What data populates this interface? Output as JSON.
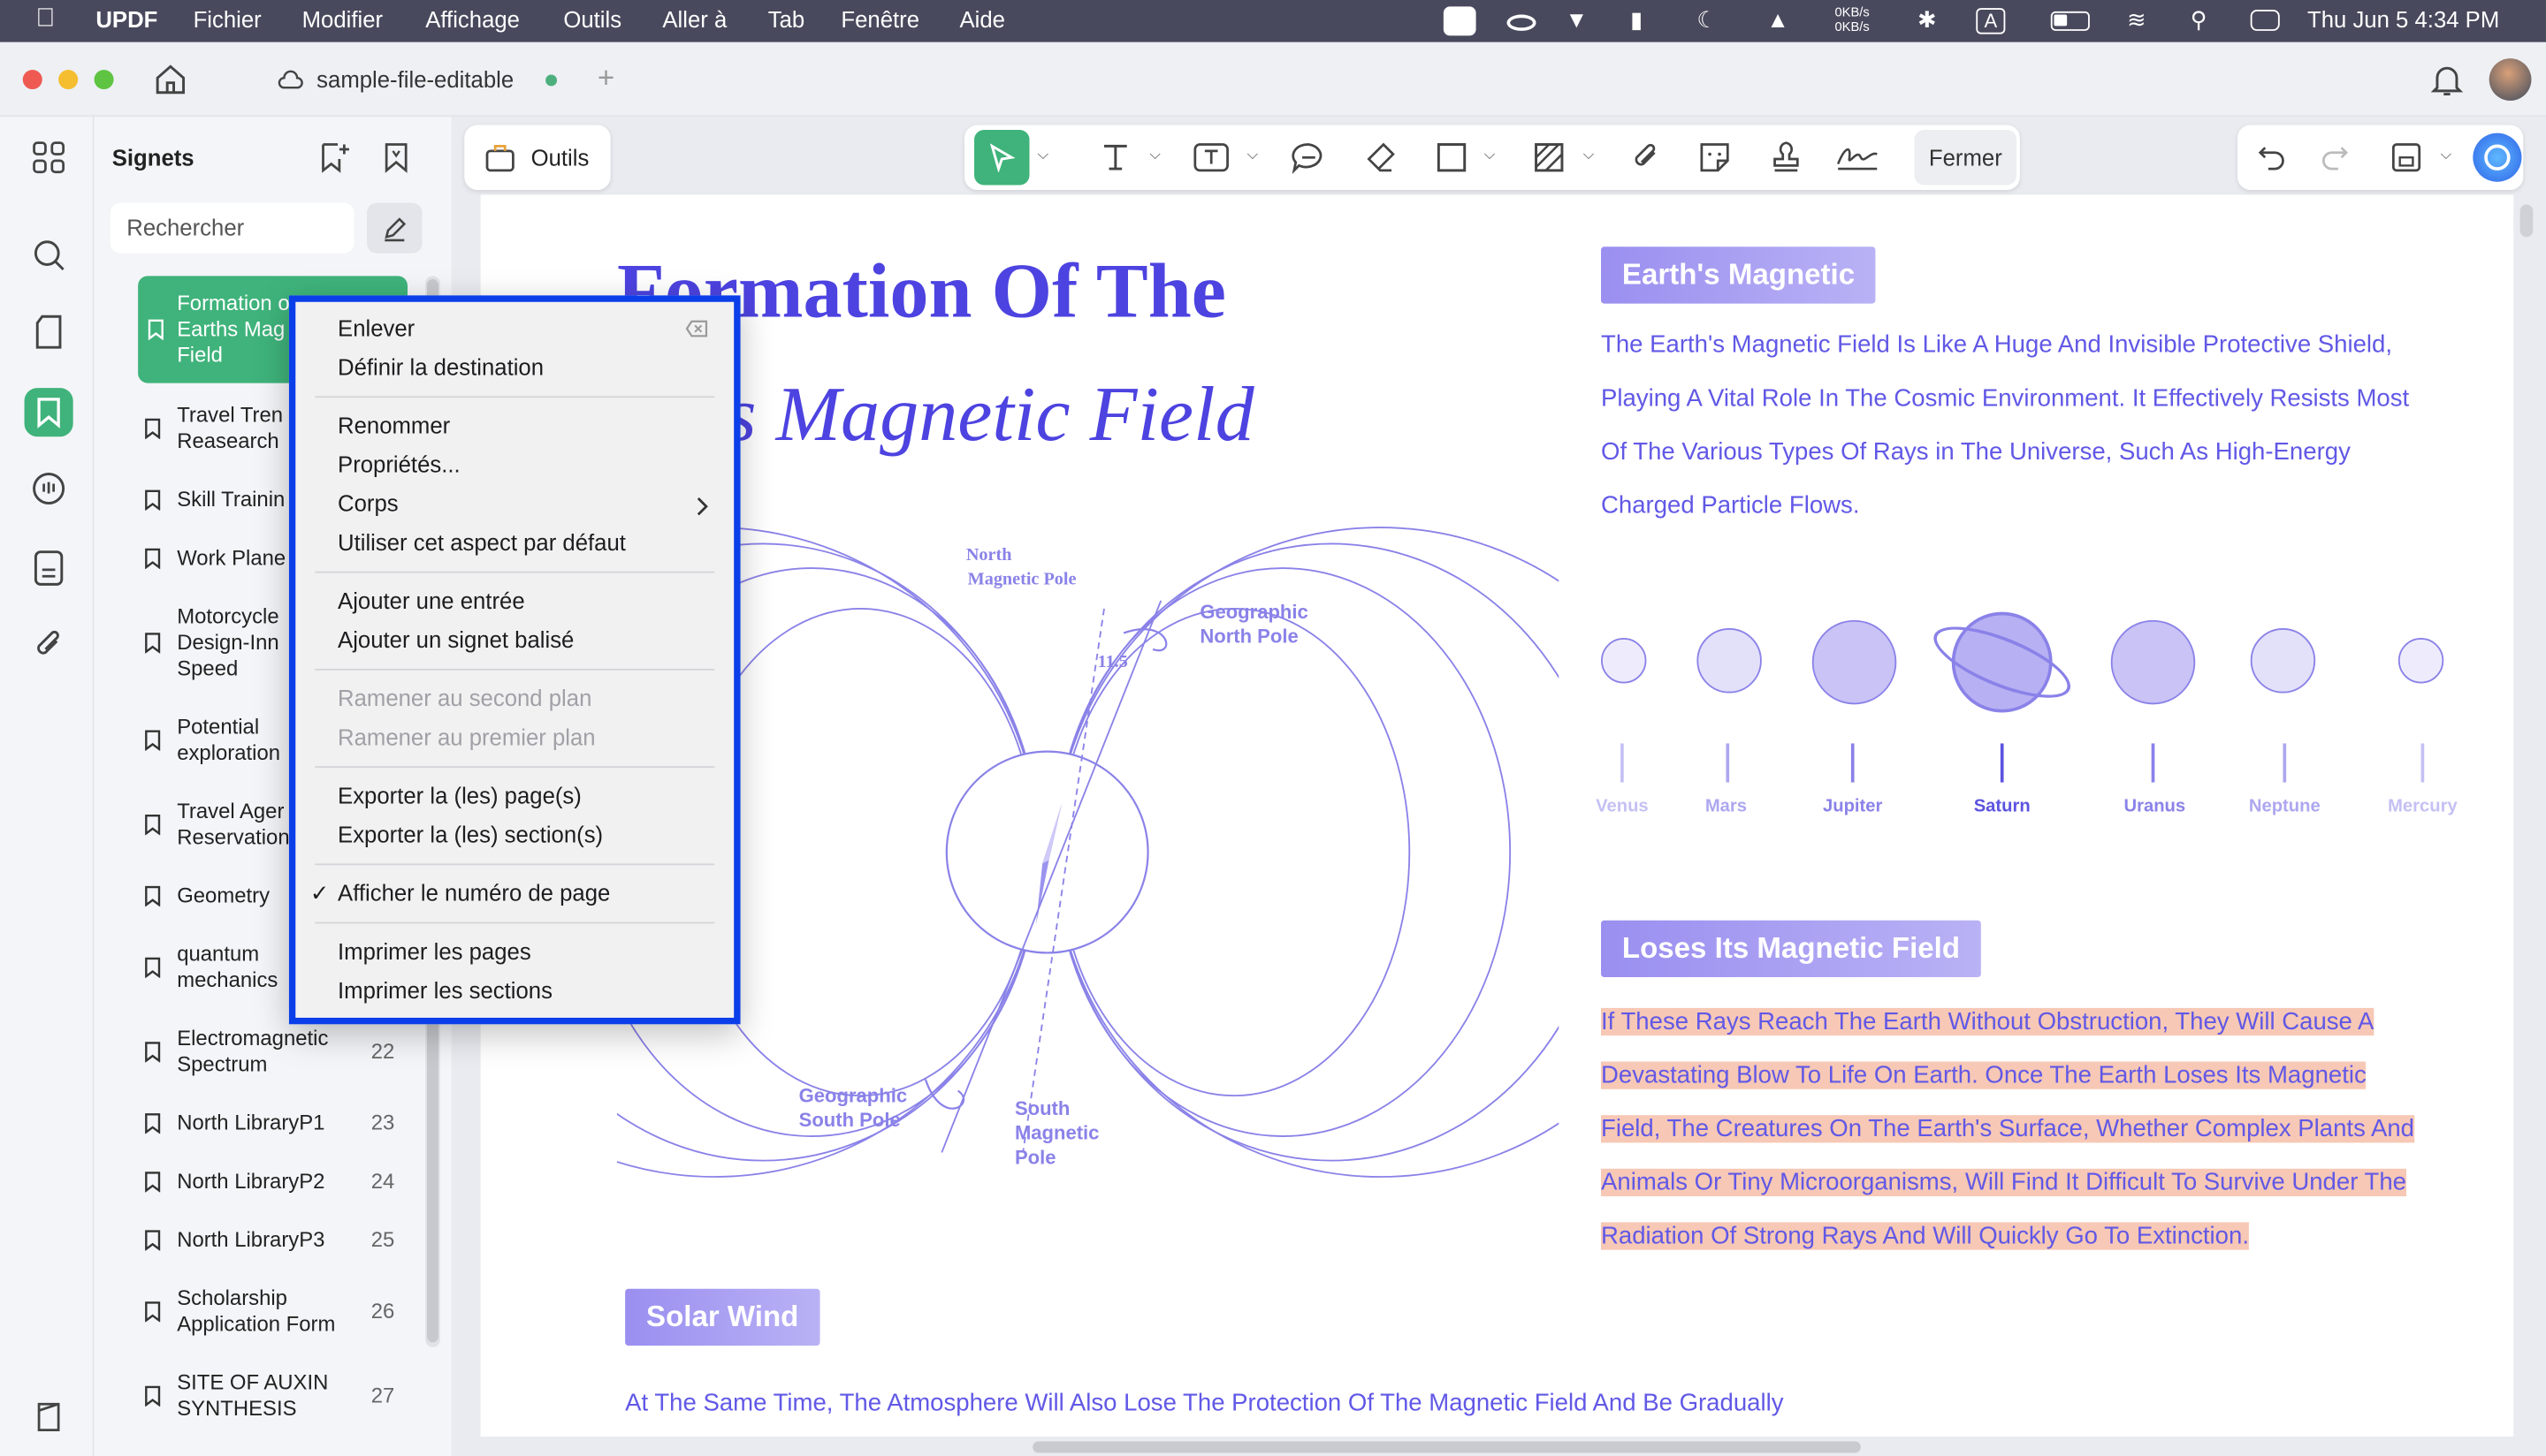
{
  "menubar": {
    "app": "UPDF",
    "items": [
      "Fichier",
      "Modifier",
      "Affichage",
      "Outils",
      "Aller à",
      "Tab",
      "Fenêtre",
      "Aide"
    ],
    "net_speed": [
      "0KB/s",
      "0KB/s"
    ],
    "input_source": "A",
    "datetime": "Thu Jun 5  4:34 PM"
  },
  "tab": {
    "title": "sample-file-editable",
    "new_tab": "+"
  },
  "panel": {
    "title": "Signets",
    "search_placeholder": "Rechercher",
    "bookmarks": [
      {
        "title": "Formation of Earths Magnetic Field",
        "lines": [
          "Formation o",
          "Earths Mag",
          "Field"
        ],
        "page": ""
      },
      {
        "title": "Travel Trends Reasearch",
        "lines": [
          "Travel Tren",
          "Reasearch"
        ],
        "page": ""
      },
      {
        "title": "Skill Training",
        "lines": [
          "Skill Trainin"
        ],
        "page": ""
      },
      {
        "title": "Work Planet",
        "lines": [
          "Work Plane"
        ],
        "page": ""
      },
      {
        "title": "Motorcycle Design-Innovation Speed",
        "lines": [
          "Motorcycle",
          "Design-Inn",
          "Speed"
        ],
        "page": ""
      },
      {
        "title": "Potential exploration",
        "lines": [
          "Potential",
          "exploration"
        ],
        "page": ""
      },
      {
        "title": "Travel Agency Reservation",
        "lines": [
          "Travel Ager",
          "Reservation"
        ],
        "page": ""
      },
      {
        "title": "Geometry",
        "lines": [
          "Geometry"
        ],
        "page": ""
      },
      {
        "title": "quantum mechanics",
        "lines": [
          "quantum",
          "mechanics"
        ],
        "page": ""
      },
      {
        "title": "Electromagnetic Spectrum",
        "lines": [
          "Electromagnetic",
          "Spectrum"
        ],
        "page": "22"
      },
      {
        "title": "North LibraryP1",
        "lines": [
          "North LibraryP1"
        ],
        "page": "23"
      },
      {
        "title": "North LibraryP2",
        "lines": [
          "North LibraryP2"
        ],
        "page": "24"
      },
      {
        "title": "North LibraryP3",
        "lines": [
          "North LibraryP3"
        ],
        "page": "25"
      },
      {
        "title": "Scholarship Application Form",
        "lines": [
          "Scholarship",
          "Application Form"
        ],
        "page": "26"
      },
      {
        "title": "SITE OF AUXIN SYNTHESIS",
        "lines": [
          "SITE OF AUXIN",
          "SYNTHESIS"
        ],
        "page": "27"
      }
    ]
  },
  "toolbar": {
    "tools_label": "Outils",
    "close_label": "Fermer"
  },
  "context_menu": {
    "items": [
      {
        "label": "Enlever",
        "enabled": true
      },
      {
        "label": "Définir la destination",
        "enabled": true
      },
      {
        "label": "Renommer",
        "enabled": true
      },
      {
        "label": "Propriétés...",
        "enabled": true
      },
      {
        "label": "Corps",
        "enabled": true,
        "submenu": true
      },
      {
        "label": "Utiliser cet aspect par défaut",
        "enabled": true
      },
      {
        "label": "Ajouter une entrée",
        "enabled": true
      },
      {
        "label": "Ajouter un signet balisé",
        "enabled": true
      },
      {
        "label": "Ramener au second plan",
        "enabled": false
      },
      {
        "label": "Ramener au premier plan",
        "enabled": false
      },
      {
        "label": "Exporter la (les) page(s)",
        "enabled": true
      },
      {
        "label": "Exporter la (les) section(s)",
        "enabled": true
      },
      {
        "label": "Afficher le numéro de page",
        "enabled": true,
        "checked": true
      },
      {
        "label": "Imprimer les pages",
        "enabled": true
      },
      {
        "label": "Imprimer les sections",
        "enabled": true
      }
    ],
    "check_mark": "✓"
  },
  "document": {
    "title_line1": "Formation Of The",
    "title_line2": "th’s Magnetic Field",
    "diagram": {
      "north_magnetic_pole": [
        "North",
        "Magnetic Pole"
      ],
      "geographic_north_pole": [
        "Geographic",
        "North Pole"
      ],
      "angle": "11.5",
      "geographic_south_pole": [
        "Geographic",
        "South Pole"
      ],
      "south_magnetic_pole": [
        "South",
        "Magnetic",
        "Pole"
      ]
    },
    "earths_magnetic_tag": "Earth's Magnetic",
    "earths_magnetic_lines": [
      "The Earth's Magnetic Field Is Like A Huge And Invisible Protective Shield,",
      "Playing A Vital Role In The Cosmic Environment. It Effectively Resists Most",
      "Of The Various Types Of Rays in The Universe, Such As High-Energy",
      "Charged Particle Flows."
    ],
    "planets": [
      "Venus",
      "Mars",
      "Jupiter",
      "Saturn",
      "Uranus",
      "Neptune",
      "Mercury"
    ],
    "loses_tag": "Loses Its Magnetic Field",
    "loses_lines": [
      "If These Rays Reach The Earth Without Obstruction, They Will Cause A",
      "Devastating Blow To Life On Earth. Once The Earth Loses Its Magnetic",
      "Field, The Creatures On The Earth's Surface, Whether Complex Plants And",
      "Animals Or Tiny Microorganisms, Will Find It Difficult To Survive Under The",
      "Radiation Of Strong Rays And Will Quickly Go To Extinction."
    ],
    "solar_wind_tag": "Solar Wind",
    "solar_wind_text": "At The Same Time, The Atmosphere Will Also Lose The Protection Of The Magnetic Field And Be Gradually"
  },
  "colors": {
    "accent_green": "#4caf7d",
    "doc_purple": "#6158e6",
    "menu_border": "#0a3ee8",
    "highlight": "#f7c8b5"
  }
}
